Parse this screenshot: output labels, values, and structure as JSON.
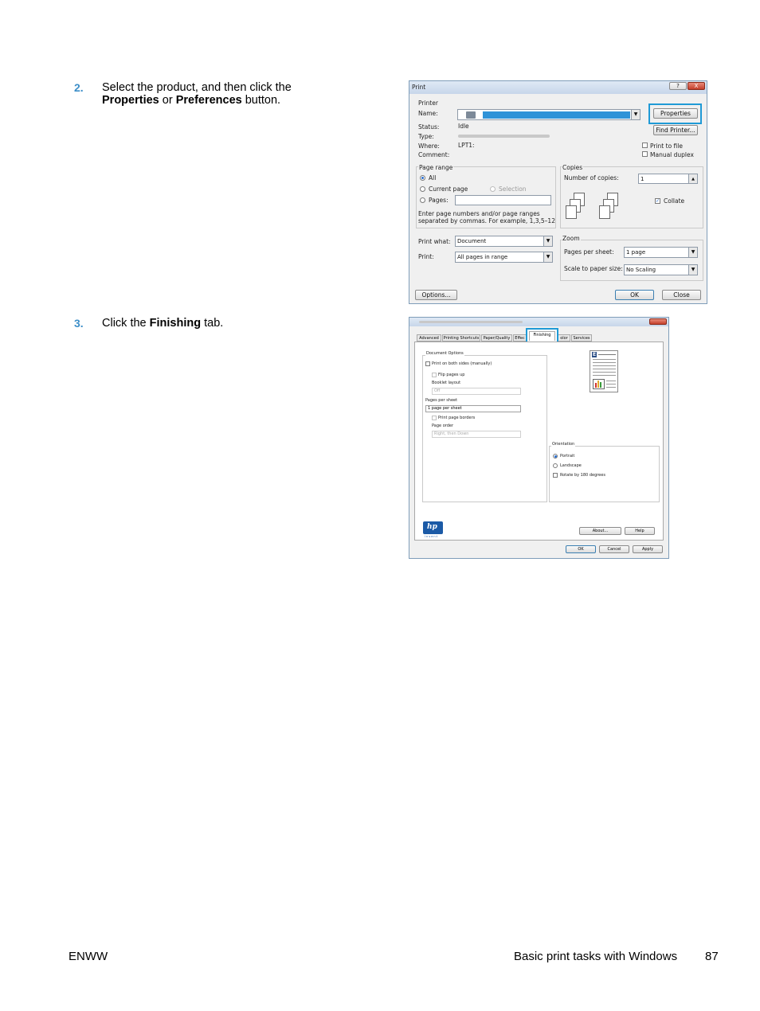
{
  "steps": [
    {
      "number": "2.",
      "line1": "Select the product, and then click the",
      "bold1": "Properties",
      "mid": " or ",
      "bold2": "Preferences",
      "tail": " button."
    },
    {
      "number": "3.",
      "pre": "Click the ",
      "bold": "Finishing",
      "post": " tab."
    }
  ],
  "print_dialog": {
    "title": "Print",
    "printer_group": "Printer",
    "name_label": "Name:",
    "status_label": "Status:",
    "status_value": "Idle",
    "type_label": "Type:",
    "where_label": "Where:",
    "where_value": "LPT1:",
    "comment_label": "Comment:",
    "properties_button": "Properties",
    "find_printer_button": "Find Printer...",
    "print_to_file": "Print to file",
    "manual_duplex": "Manual duplex",
    "page_range_group": "Page range",
    "all_label": "All",
    "current_page_label": "Current page",
    "selection_label": "Selection",
    "pages_label": "Pages:",
    "page_range_help1": "Enter page numbers and/or page ranges",
    "page_range_help2": "separated by commas.  For example, 1,3,5–12",
    "copies_group": "Copies",
    "number_of_copies_label": "Number of copies:",
    "copies_value": "1",
    "collate_label": "Collate",
    "print_what_label": "Print what:",
    "print_what_value": "Document",
    "print_label": "Print:",
    "print_value": "All pages in range",
    "zoom_group": "Zoom",
    "pages_per_sheet_label": "Pages per sheet:",
    "pages_per_sheet_value": "1 page",
    "scale_label": "Scale to paper size:",
    "scale_value": "No Scaling",
    "options_button": "Options...",
    "ok_button": "OK",
    "close_button": "Close",
    "help_glyph": "?",
    "close_glyph": "X"
  },
  "properties_dialog": {
    "tabs": [
      "Advanced",
      "Printing Shortcuts",
      "Paper/Quality",
      "Effec",
      "Finishing",
      "olor",
      "Services"
    ],
    "document_options_group": "Document Options",
    "print_both_sides": "Print on both sides (manually)",
    "flip_pages_up": "Flip pages up",
    "booklet_layout": "Booklet layout",
    "booklet_value": "Off",
    "pages_per_sheet_label": "Pages per sheet",
    "pages_per_sheet_value": "1 page per sheet",
    "print_page_borders": "Print page borders",
    "page_order_label": "Page order",
    "page_order_value": "Right, then Down",
    "orientation_group": "Orientation",
    "portrait": "Portrait",
    "landscape": "Landscape",
    "rotate": "Rotate by 180 degrees",
    "about_button": "About...",
    "help_button": "Help",
    "ok_button": "OK",
    "cancel_button": "Cancel",
    "apply_button": "Apply",
    "logo_text": "hp",
    "logo_sub": "invent",
    "preview_letter": "E"
  },
  "footer": {
    "left": "ENWW",
    "right": "Basic print tasks with Windows",
    "page": "87"
  },
  "colors": {
    "step_number": "#3d8fc9",
    "highlight": "#1f9ad6"
  }
}
